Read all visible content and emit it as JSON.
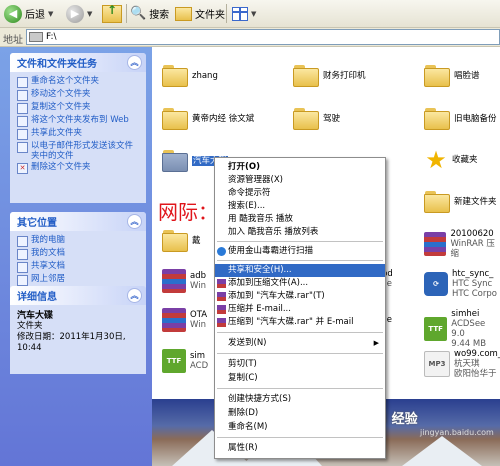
{
  "toolbar": {
    "back_label": "后退",
    "search_label": "搜索",
    "folders_label": "文件夹"
  },
  "address": {
    "label": "地址",
    "value": "F:\\"
  },
  "file_tasks": {
    "title": "文件和文件夹任务",
    "items": [
      "重命名这个文件夹",
      "移动这个文件夹",
      "复制这个文件夹",
      "将这个文件夹发布到 Web",
      "共享此文件夹",
      "以电子邮件形式发送该文件夹中的文件",
      "删除这个文件夹"
    ]
  },
  "other_places": {
    "title": "其它位置",
    "items": [
      "我的电脑",
      "我的文档",
      "共享文档",
      "网上邻居"
    ]
  },
  "details": {
    "title": "详细信息",
    "name": "汽车大碟",
    "type": "文件夹",
    "modified_label": "修改日期：2011年1月30日,",
    "modified_time": "10:44"
  },
  "files": [
    {
      "name": "zhang",
      "sub": ""
    },
    {
      "name": "财务打印机",
      "sub": ""
    },
    {
      "name": "唱脸谱",
      "sub": ""
    },
    {
      "name": "黄帝内经 徐文斌",
      "sub": ""
    },
    {
      "name": "驾驶",
      "sub": ""
    },
    {
      "name": "旧电脑备份",
      "sub": ""
    },
    {
      "name": "汽车大碟",
      "sub": ""
    },
    {
      "name": "收藏夹",
      "sub": ""
    },
    {
      "name": "新建文件夹",
      "sub": ""
    },
    {
      "name": "戴",
      "sub": ""
    },
    {
      "name": "20100620",
      "sub": "WinRAR 压缩"
    },
    {
      "name": "adb",
      "sub": "Win"
    },
    {
      "name": "pd",
      "sub": "ile"
    },
    {
      "name": "htc_sync_",
      "sub": "HTC Sync"
    },
    {
      "name": "",
      "sub": "HTC Corpo"
    },
    {
      "name": "OTA",
      "sub": "Win"
    },
    {
      "name": "",
      "sub": "ile"
    },
    {
      "name": "simhei",
      "sub": "ACDSee 9.0"
    },
    {
      "name": "",
      "sub": "9.44 MB"
    },
    {
      "name": "sim",
      "sub": "ACD"
    },
    {
      "name": "wo99.com_",
      "sub": "杭天琪"
    },
    {
      "name": "",
      "sub": "欧阳怡华于"
    }
  ],
  "context_menu": {
    "items": [
      "打开(O)",
      "资源管理器(X)",
      "命令提示符",
      "搜索(E)...",
      "用 酷我音乐 播放",
      "加入 酷我音乐 播放列表",
      "使用金山毒霸进行扫描",
      "共享和安全(H)...",
      "添加到压缩文件(A)...",
      "添加到 \"汽车大碟.rar\"(T)",
      "压缩并 E-mail...",
      "压缩到 \"汽车大碟.rar\" 并 E-mail",
      "发送到(N)",
      "剪切(T)",
      "复制(C)",
      "创建快捷方式(S)",
      "删除(D)",
      "重命名(M)",
      "属性(R)"
    ]
  },
  "watermarks": {
    "site": "网际：wzdiy.cn",
    "baidu": "Bai 经验",
    "baidu_url": "jingyan.baidu.com"
  },
  "colors": {
    "highlight": "#316ac5",
    "task_link": "#215dc6",
    "watermark_red": "#e0151b"
  }
}
